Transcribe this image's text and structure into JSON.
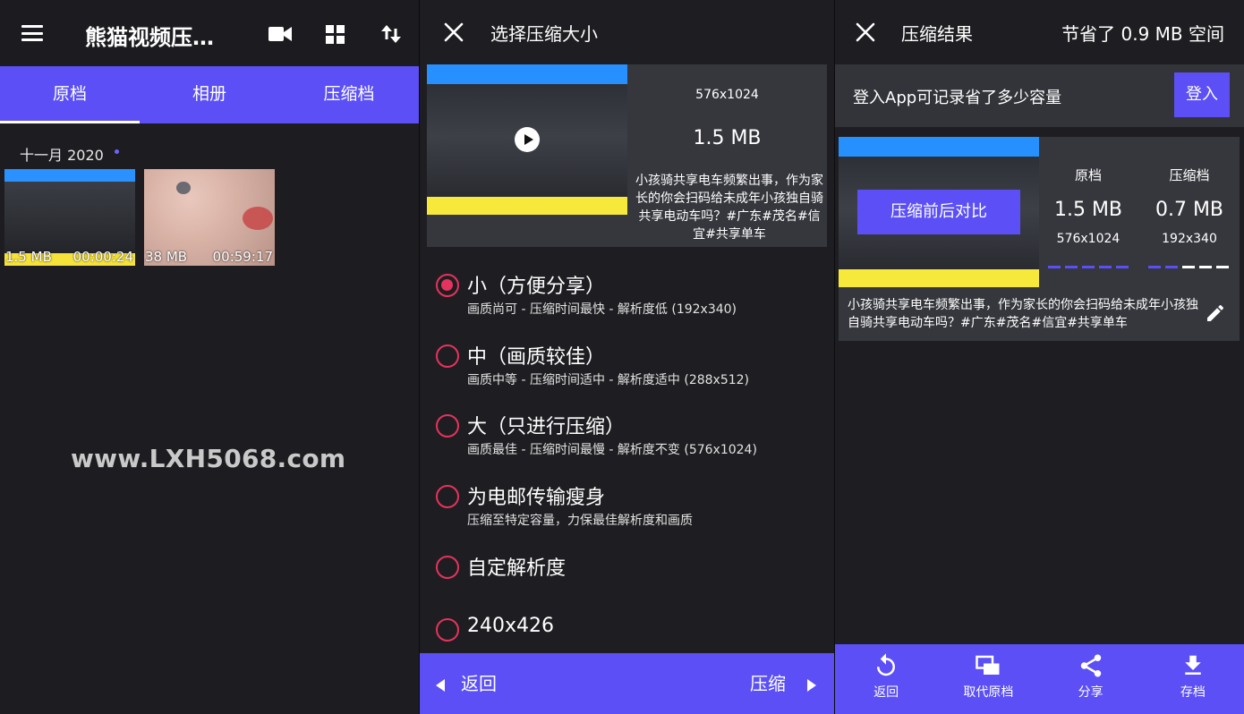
{
  "panel1": {
    "title": "熊猫视频压…",
    "tabs": [
      {
        "label": "原档",
        "active": true
      },
      {
        "label": "相册",
        "active": false
      },
      {
        "label": "压缩档",
        "active": false
      }
    ],
    "date_header": "十一月 2020",
    "thumbnails": [
      {
        "size": "1.5 MB",
        "duration": "00:00:24"
      },
      {
        "size": "38 MB",
        "duration": "00:59:17"
      }
    ],
    "watermark": "www.LXH5068.com",
    "icons": [
      "menu-icon",
      "video-camera-icon",
      "grid-icon",
      "sort-icon"
    ]
  },
  "panel2": {
    "title": "选择压缩大小",
    "video": {
      "resolution": "576x1024",
      "size": "1.5 MB",
      "description": "小孩骑共享电车频繁出事，作为家长的你会扫码给未成年小孩独自骑共享电动车吗？#广东#茂名#信宜#共享单车"
    },
    "options": [
      {
        "title": "小（方便分享）",
        "subtitle": "画质尚可 - 压缩时间最快 - 解析度低 (192x340)",
        "selected": true
      },
      {
        "title": "中（画质较佳）",
        "subtitle": "画质中等 - 压缩时间适中 - 解析度适中 (288x512)",
        "selected": false
      },
      {
        "title": "大（只进行压缩）",
        "subtitle": "画质最佳 - 压缩时间最慢 - 解析度不变 (576x1024)",
        "selected": false
      },
      {
        "title": "为电邮传输瘦身",
        "subtitle": "压缩至特定容量，力保最佳解析度和画质",
        "selected": false
      },
      {
        "title": "自定解析度",
        "subtitle": "",
        "selected": false
      },
      {
        "title": "240x426",
        "subtitle": "",
        "selected": false
      }
    ],
    "back_label": "返回",
    "compress_label": "压缩"
  },
  "panel3": {
    "title": "压缩结果",
    "saved_text": "节省了 0.9 MB 空间",
    "login_prompt": "登入App可记录省了多少容量",
    "login_label": "登入",
    "compare_label": "压缩前后对比",
    "original": {
      "label": "原档",
      "size": "1.5 MB",
      "resolution": "576x1024"
    },
    "compressed": {
      "label": "压缩档",
      "size": "0.7 MB",
      "resolution": "192x340"
    },
    "description": "小孩骑共享电车频繁出事，作为家长的你会扫码给未成年小孩独自骑共享电动车吗？#广东#茂名#信宜#共享单车",
    "actions": [
      {
        "label": "返回",
        "icon": "undo-icon"
      },
      {
        "label": "取代原档",
        "icon": "replace-icon"
      },
      {
        "label": "分享",
        "icon": "share-icon"
      },
      {
        "label": "存档",
        "icon": "download-icon"
      }
    ]
  },
  "colors": {
    "accent": "#5b4ff5",
    "radio": "#e6335d",
    "background": "#1e1e22",
    "card": "#36373d"
  }
}
